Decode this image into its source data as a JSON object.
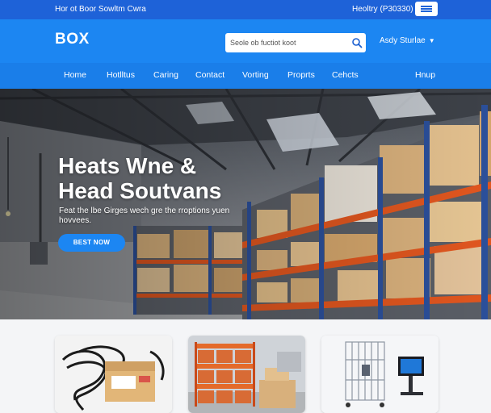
{
  "topbar": {
    "left_text": "Hor ot Boor Sowltm Cwra",
    "right_text": "Heoltry (P30330)"
  },
  "header": {
    "logo": "BOX",
    "search_placeholder": "Seole ob fuctiot koot",
    "account_label": "Asdy Sturlae"
  },
  "nav": {
    "items": [
      "Home",
      "Hotlltus",
      "Caring",
      "Contact",
      "Vorting",
      "Proprts",
      "Cehcts",
      "Hnup"
    ]
  },
  "hero": {
    "title_line1": "Heats Wne &",
    "title_line2": "Head Soutvans",
    "subtitle": "Feat the lbe Girges wech gre the rroptions yuen hovvees.",
    "button_label": "BEST NOW"
  },
  "colors": {
    "topbar": "#1e62d8",
    "header": "#1c86f2",
    "nav": "#1a7ee9",
    "accent_button": "#1c86f2",
    "rack_orange": "#e0561f",
    "rack_blue": "#2b4f9a",
    "box_cardboard": "#d8b07c"
  },
  "cards": [
    {
      "icon": "cable-product-image"
    },
    {
      "icon": "warehouse-shelves-image"
    },
    {
      "icon": "wire-cart-monitor-image"
    }
  ]
}
